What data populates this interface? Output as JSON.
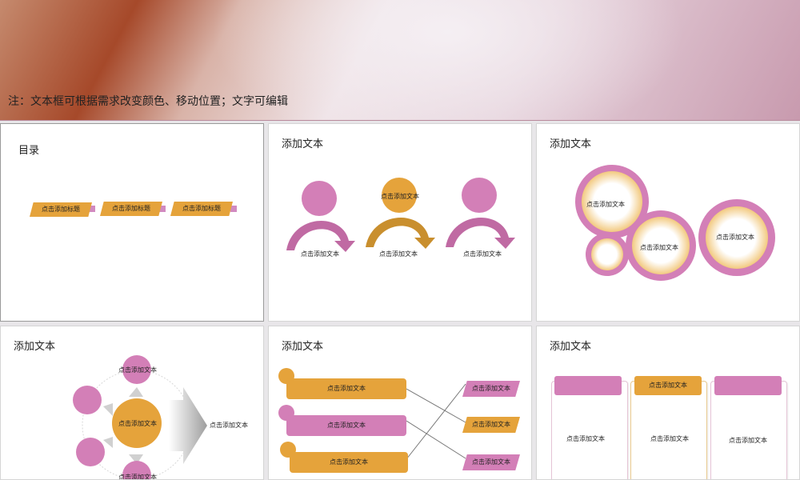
{
  "banner": {
    "note": "注：文本框可根据需求改变颜色、移动位置；文字可编辑"
  },
  "colors": {
    "pink": "#d37fb7",
    "orange": "#e5a33b",
    "panel": "#ffffff"
  },
  "panel1": {
    "title": "目录",
    "tags": [
      "点击添加标题",
      "点击添加标题",
      "点击添加标题"
    ]
  },
  "panel2": {
    "title": "添加文本",
    "people": [
      "点击添加文本",
      "点击添加文本",
      "点击添加文本"
    ],
    "head_label": "点击添加文本"
  },
  "panel3": {
    "title": "添加文本",
    "circles": [
      "点击添加文本",
      "点击添加文本",
      "点击添加文本"
    ]
  },
  "panel4": {
    "title": "添加文本",
    "top": "点击添加文本",
    "center": "点击添加文本",
    "bottom": "点击添加文本",
    "arrow": "点击添加文本"
  },
  "panel5": {
    "title": "添加文本",
    "left": [
      "点击添加文本",
      "点击添加文本",
      "点击添加文本"
    ],
    "right": [
      "点击添加文本",
      "点击添加文本",
      "点击添加文本"
    ]
  },
  "panel6": {
    "title": "添加文本",
    "heads": [
      "",
      "点击添加文本",
      ""
    ],
    "bodies": [
      "点击添加文本",
      "点击添加文本",
      "点击添加文本"
    ]
  }
}
